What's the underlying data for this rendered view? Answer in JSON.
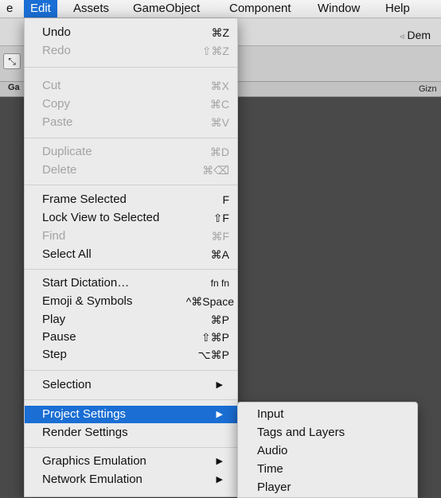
{
  "menubar": {
    "items": [
      "e",
      "Edit",
      "Assets",
      "GameObject",
      "Component",
      "Window",
      "Help"
    ]
  },
  "background": {
    "game_tab": "Ga",
    "demo_label": "Dem",
    "gizmos_label": "Gizn",
    "speaker_icon": "speaker-icon",
    "move_tool_icon": "move-tool-icon"
  },
  "edit_menu": {
    "undo": {
      "label": "Undo",
      "shortcut": "⌘Z"
    },
    "redo": {
      "label": "Redo",
      "shortcut": "⇧⌘Z"
    },
    "cut": {
      "label": "Cut",
      "shortcut": "⌘X"
    },
    "copy": {
      "label": "Copy",
      "shortcut": "⌘C"
    },
    "paste": {
      "label": "Paste",
      "shortcut": "⌘V"
    },
    "duplicate": {
      "label": "Duplicate",
      "shortcut": "⌘D"
    },
    "delete": {
      "label": "Delete",
      "shortcut": "⌘⌫"
    },
    "frame_selected": {
      "label": "Frame Selected",
      "shortcut": "F"
    },
    "lock_view": {
      "label": "Lock View to Selected",
      "shortcut": "⇧F"
    },
    "find": {
      "label": "Find",
      "shortcut": "⌘F"
    },
    "select_all": {
      "label": "Select All",
      "shortcut": "⌘A"
    },
    "start_dictation": {
      "label": "Start Dictation…",
      "shortcut": "fn fn"
    },
    "emoji": {
      "label": "Emoji & Symbols",
      "shortcut": "^⌘Space"
    },
    "play": {
      "label": "Play",
      "shortcut": "⌘P"
    },
    "pause": {
      "label": "Pause",
      "shortcut": "⇧⌘P"
    },
    "step": {
      "label": "Step",
      "shortcut": "⌥⌘P"
    },
    "selection": {
      "label": "Selection"
    },
    "project_settings": {
      "label": "Project Settings"
    },
    "render_settings": {
      "label": "Render Settings"
    },
    "graphics_emulation": {
      "label": "Graphics Emulation"
    },
    "network_emulation": {
      "label": "Network Emulation"
    },
    "submenu_arrow": "▶"
  },
  "project_settings_submenu": {
    "items": [
      "Input",
      "Tags and Layers",
      "Audio",
      "Time",
      "Player"
    ]
  },
  "colors": {
    "highlight": "#1a6ed4",
    "menu_background": "#ebebeb",
    "disabled_text": "#a3a3a3"
  }
}
